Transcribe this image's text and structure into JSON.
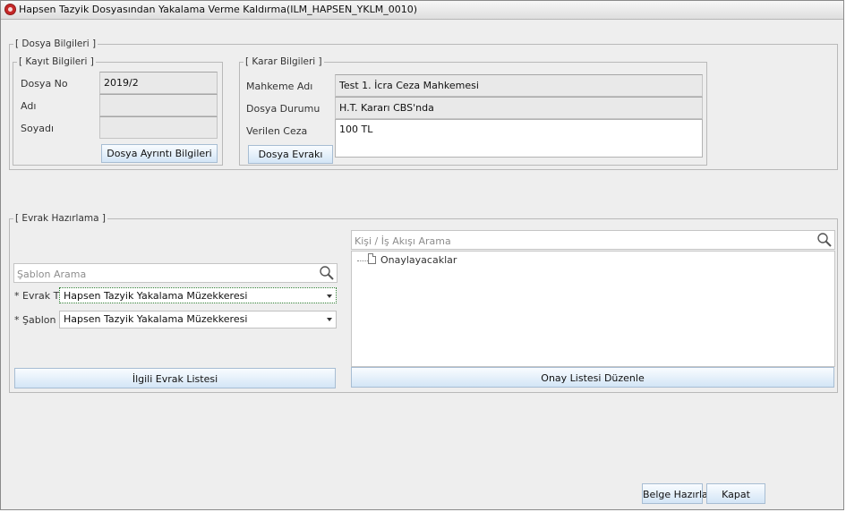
{
  "window": {
    "title": "Hapsen Tazyik Dosyasından Yakalama Verme Kaldırma(ILM_HAPSEN_YKLM_0010)"
  },
  "dosya_bilgileri": {
    "legend": "[ Dosya Bilgileri ]",
    "kayit": {
      "legend": "[ Kayıt Bilgileri ]",
      "dosya_no_label": "Dosya No",
      "dosya_no_value": "2019/2",
      "adi_label": "Adı",
      "adi_value": "",
      "soyadi_label": "Soyadı",
      "soyadi_value": "",
      "ayrinti_button": "Dosya Ayrıntı Bilgileri"
    },
    "karar": {
      "legend": "[ Karar Bilgileri ]",
      "mahkeme_label": "Mahkeme Adı",
      "mahkeme_value": "Test 1. İcra Ceza Mahkemesi",
      "durum_label": "Dosya Durumu",
      "durum_value": "H.T. Kararı CBS'nda",
      "ceza_label": "Verilen Ceza",
      "ceza_value": "100 TL",
      "evraki_button": "Dosya Evrakı"
    }
  },
  "evrak_hazirlama": {
    "legend": "[ Evrak Hazırlama ]",
    "sablon_search_placeholder": "Şablon Arama",
    "evrak_tipi_label": "* Evrak Tipi",
    "evrak_tipi_value": "Hapsen Tazyik Yakalama Müzekkeresi",
    "sablon_label": "* Şablon",
    "sablon_value": "Hapsen Tazyik Yakalama Müzekkeresi",
    "ilgili_evrak_button": "İlgili Evrak Listesi",
    "kisi_search_placeholder": "Kişi / İş Akışı Arama",
    "tree_node": "Onaylayacaklar",
    "onay_button": "Onay Listesi Düzenle"
  },
  "footer": {
    "belge_button": "Belge Hazırla",
    "kapat_button": "Kapat"
  }
}
